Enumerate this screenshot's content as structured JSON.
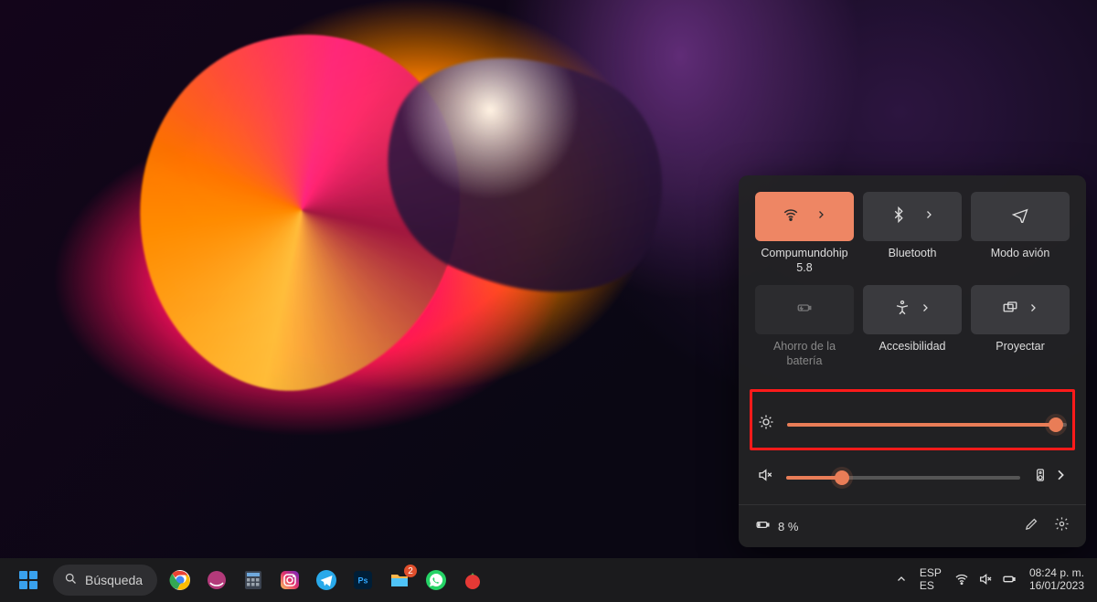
{
  "search": {
    "placeholder": "Búsqueda"
  },
  "quick_settings": {
    "tiles": [
      {
        "label": "Compumundohip 5.8",
        "active": true,
        "has_chevron": true,
        "disabled": false
      },
      {
        "label": "Bluetooth",
        "active": false,
        "has_chevron": true,
        "disabled": false
      },
      {
        "label": "Modo avión",
        "active": false,
        "has_chevron": false,
        "disabled": false
      },
      {
        "label": "Ahorro de la batería",
        "active": false,
        "has_chevron": false,
        "disabled": true
      },
      {
        "label": "Accesibilidad",
        "active": false,
        "has_chevron": true,
        "disabled": false
      },
      {
        "label": "Proyectar",
        "active": false,
        "has_chevron": true,
        "disabled": false
      }
    ],
    "brightness_percent": 96,
    "volume_percent": 24,
    "battery_text": "8 %"
  },
  "taskbar": {
    "apps_badge": {
      "explorer": "2"
    },
    "lang_line1": "ESP",
    "lang_line2": "ES",
    "time": "08:24 p. m.",
    "date": "16/01/2023"
  }
}
